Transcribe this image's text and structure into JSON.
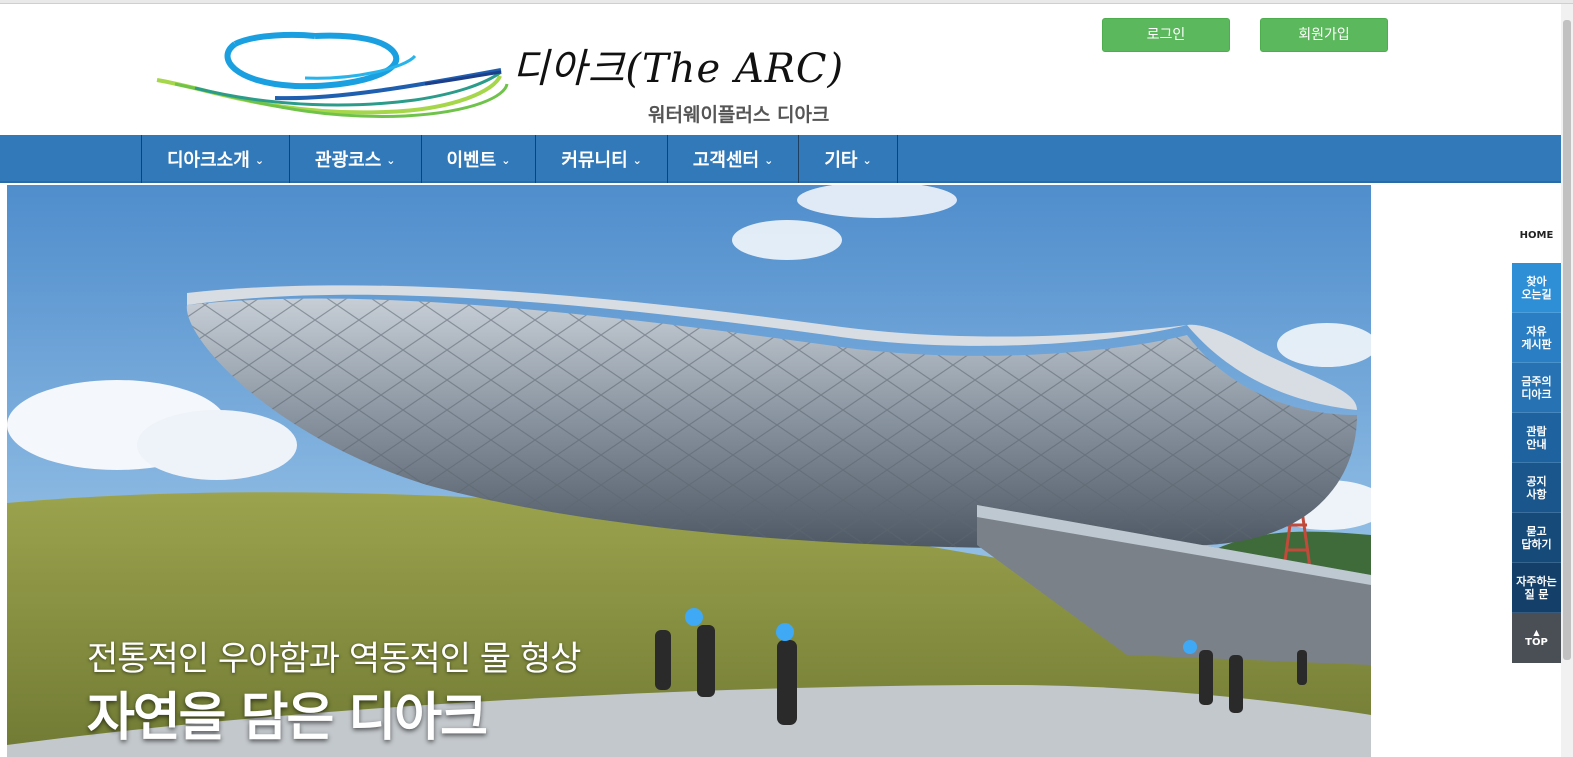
{
  "header": {
    "logo_title": "디아크(The ARC)",
    "logo_subtitle": "워터웨이플러스 디아크",
    "login_label": "로그인",
    "join_label": "회원가입",
    "button_color": "#5cb85c"
  },
  "nav": {
    "color": "#3279b9",
    "items": [
      {
        "label": "디아크소개"
      },
      {
        "label": "관광코스"
      },
      {
        "label": "이벤트"
      },
      {
        "label": "커뮤니티"
      },
      {
        "label": "고객센터"
      },
      {
        "label": "기타"
      }
    ],
    "caret": "⌄"
  },
  "hero": {
    "line1": "전통적인 우아함과 역동적인 물 형상",
    "line2": "자연을 담은 디아크"
  },
  "side_menu": {
    "home_label": "HOME",
    "items": [
      {
        "label": "찾아\n오는길",
        "color": "#2e8fd6"
      },
      {
        "label": "자유\n게시판",
        "color": "#2a7fc4"
      },
      {
        "label": "금주의\n디아크",
        "color": "#2672b3"
      },
      {
        "label": "관람\n안내",
        "color": "#1e639f"
      },
      {
        "label": "공지\n사항",
        "color": "#1a568c"
      },
      {
        "label": "묻고\n답하기",
        "color": "#164a79"
      },
      {
        "label": "자주하는\n질 문",
        "color": "#133f68"
      }
    ],
    "top_arrow": "▲",
    "top_label": "TOP"
  }
}
